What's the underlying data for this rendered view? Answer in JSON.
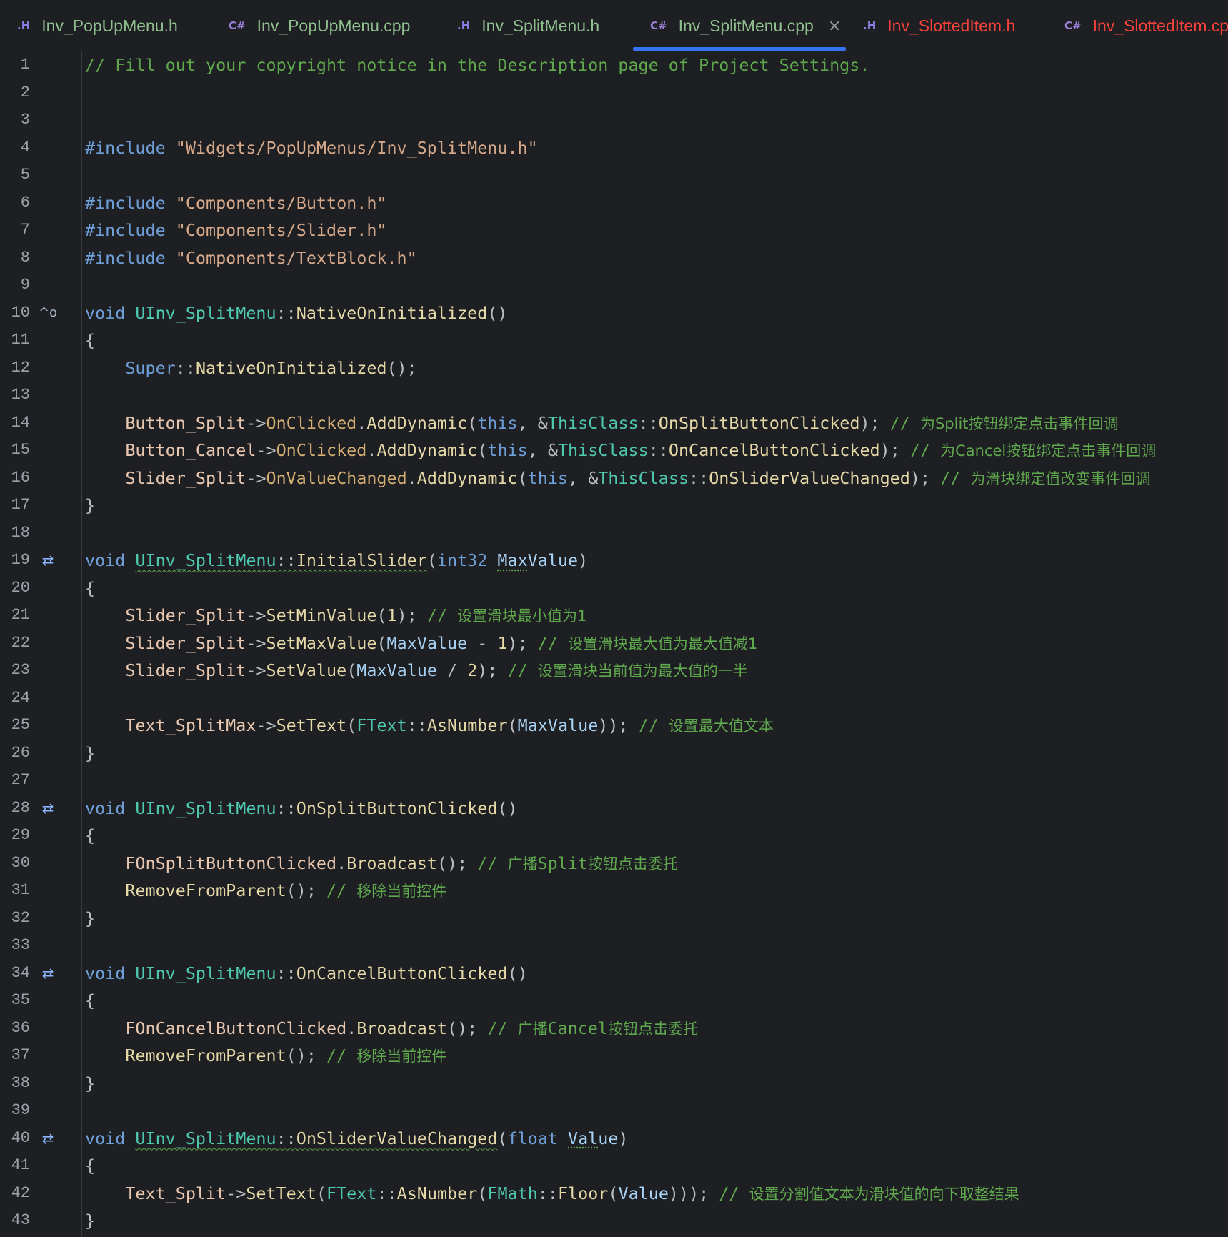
{
  "tabs": [
    {
      "label": "Inv_PopUpMenu.h",
      "type": "h",
      "icon": ".H",
      "state": "normal"
    },
    {
      "label": "Inv_PopUpMenu.cpp",
      "type": "cpp",
      "icon": "C#",
      "state": "normal"
    },
    {
      "label": "Inv_SplitMenu.h",
      "type": "h",
      "icon": ".H",
      "state": "normal"
    },
    {
      "label": "Inv_SplitMenu.cpp",
      "type": "cpp",
      "icon": "C#",
      "state": "active"
    },
    {
      "label": "Inv_SlottedItem.h",
      "type": "h",
      "icon": ".H",
      "state": "error"
    },
    {
      "label": "Inv_SlottedItem.cpp",
      "type": "cpp",
      "icon": "C#",
      "state": "error"
    }
  ],
  "active_tab_close": "×",
  "gutter_icons": {
    "10": {
      "name": "override-icon",
      "glyph": "^o"
    },
    "19": {
      "name": "implementation-switch-icon",
      "glyph": "⇄"
    },
    "28": {
      "name": "implementation-switch-icon",
      "glyph": "⇄"
    },
    "34": {
      "name": "implementation-switch-icon",
      "glyph": "⇄"
    },
    "40": {
      "name": "implementation-switch-icon",
      "glyph": "⇄"
    }
  },
  "lines": [
    [
      [
        "cm",
        "// Fill out your copyright notice in the Description page of Project Settings."
      ]
    ],
    [],
    [],
    [
      [
        "pp",
        "#include "
      ],
      [
        "str",
        "\"Widgets/PopUpMenus/Inv_SplitMenu.h\""
      ]
    ],
    [],
    [
      [
        "pp",
        "#include "
      ],
      [
        "str",
        "\"Components/Button.h\""
      ]
    ],
    [
      [
        "pp",
        "#include "
      ],
      [
        "str",
        "\"Components/Slider.h\""
      ]
    ],
    [
      [
        "pp",
        "#include "
      ],
      [
        "str",
        "\"Components/TextBlock.h\""
      ]
    ],
    [],
    [
      [
        "kw",
        "void "
      ],
      [
        "cls",
        "UInv_SplitMenu"
      ],
      [
        "pn",
        "::"
      ],
      [
        "fn",
        "NativeOnInitialized"
      ],
      [
        "pn",
        "()"
      ]
    ],
    [
      [
        "pn",
        "{"
      ]
    ],
    [
      [
        "pn",
        "    "
      ],
      [
        "sup",
        "Super"
      ],
      [
        "pn",
        "::"
      ],
      [
        "fn",
        "NativeOnInitialized"
      ],
      [
        "pn",
        "();"
      ]
    ],
    [],
    [
      [
        "pn",
        "    "
      ],
      [
        "var",
        "Button_Split"
      ],
      [
        "op",
        "->"
      ],
      [
        "mac",
        "OnClicked"
      ],
      [
        "pn",
        "."
      ],
      [
        "fn",
        "AddDynamic"
      ],
      [
        "pn",
        "("
      ],
      [
        "kw",
        "this"
      ],
      [
        "pn",
        ", &"
      ],
      [
        "cls",
        "ThisClass"
      ],
      [
        "pn",
        "::"
      ],
      [
        "fn",
        "OnSplitButtonClicked"
      ],
      [
        "pn",
        "); "
      ],
      [
        "cm",
        "// "
      ],
      [
        "cmz",
        "为Split按钮绑定点击事件回调"
      ]
    ],
    [
      [
        "pn",
        "    "
      ],
      [
        "var",
        "Button_Cancel"
      ],
      [
        "op",
        "->"
      ],
      [
        "mac",
        "OnClicked"
      ],
      [
        "pn",
        "."
      ],
      [
        "fn",
        "AddDynamic"
      ],
      [
        "pn",
        "("
      ],
      [
        "kw",
        "this"
      ],
      [
        "pn",
        ", &"
      ],
      [
        "cls",
        "ThisClass"
      ],
      [
        "pn",
        "::"
      ],
      [
        "fn",
        "OnCancelButtonClicked"
      ],
      [
        "pn",
        "); "
      ],
      [
        "cm",
        "// "
      ],
      [
        "cmz",
        "为Cancel按钮绑定点击事件回调"
      ]
    ],
    [
      [
        "pn",
        "    "
      ],
      [
        "var",
        "Slider_Split"
      ],
      [
        "op",
        "->"
      ],
      [
        "mac",
        "OnValueChanged"
      ],
      [
        "pn",
        "."
      ],
      [
        "fn",
        "AddDynamic"
      ],
      [
        "pn",
        "("
      ],
      [
        "kw",
        "this"
      ],
      [
        "pn",
        ", &"
      ],
      [
        "cls",
        "ThisClass"
      ],
      [
        "pn",
        "::"
      ],
      [
        "fn",
        "OnSliderValueChanged"
      ],
      [
        "pn",
        "); "
      ],
      [
        "cm",
        "// "
      ],
      [
        "cmz",
        "为滑块绑定值改变事件回调"
      ]
    ],
    [
      [
        "pn",
        "}"
      ]
    ],
    [],
    [
      [
        "kw",
        "void "
      ],
      [
        "cls squig",
        "UInv_SplitMenu"
      ],
      [
        "pn squig",
        "::"
      ],
      [
        "fn squig",
        "InitialSlider"
      ],
      [
        "pn",
        "("
      ],
      [
        "kw",
        "int32 "
      ],
      [
        "prm dotu",
        "Max"
      ],
      [
        "prm",
        "Value"
      ],
      [
        "pn",
        ")"
      ]
    ],
    [
      [
        "pn",
        "{"
      ]
    ],
    [
      [
        "pn",
        "    "
      ],
      [
        "var",
        "Slider_Split"
      ],
      [
        "op",
        "->"
      ],
      [
        "fn",
        "SetMinValue"
      ],
      [
        "pn",
        "("
      ],
      [
        "num",
        "1"
      ],
      [
        "pn",
        "); "
      ],
      [
        "cm",
        "// "
      ],
      [
        "cmz",
        "设置滑块最小值为1"
      ]
    ],
    [
      [
        "pn",
        "    "
      ],
      [
        "var",
        "Slider_Split"
      ],
      [
        "op",
        "->"
      ],
      [
        "fn",
        "SetMaxValue"
      ],
      [
        "pn",
        "("
      ],
      [
        "prm",
        "MaxValue"
      ],
      [
        "pn",
        " - "
      ],
      [
        "num",
        "1"
      ],
      [
        "pn",
        "); "
      ],
      [
        "cm",
        "// "
      ],
      [
        "cmz",
        "设置滑块最大值为最大值减1"
      ]
    ],
    [
      [
        "pn",
        "    "
      ],
      [
        "var",
        "Slider_Split"
      ],
      [
        "op",
        "->"
      ],
      [
        "fn",
        "SetValue"
      ],
      [
        "pn",
        "("
      ],
      [
        "prm",
        "MaxValue"
      ],
      [
        "pn",
        " / "
      ],
      [
        "num",
        "2"
      ],
      [
        "pn",
        "); "
      ],
      [
        "cm",
        "// "
      ],
      [
        "cmz",
        "设置滑块当前值为最大值的一半"
      ]
    ],
    [],
    [
      [
        "pn",
        "    "
      ],
      [
        "var",
        "Text_SplitMax"
      ],
      [
        "op",
        "->"
      ],
      [
        "fn",
        "SetText"
      ],
      [
        "pn",
        "("
      ],
      [
        "cls",
        "FText"
      ],
      [
        "pn",
        "::"
      ],
      [
        "fn",
        "AsNumber"
      ],
      [
        "pn",
        "("
      ],
      [
        "prm",
        "MaxValue"
      ],
      [
        "pn",
        "));"
      ],
      [
        "pn",
        " "
      ],
      [
        "cm",
        "// "
      ],
      [
        "cmz",
        "设置最大值文本"
      ]
    ],
    [
      [
        "pn",
        "}"
      ]
    ],
    [],
    [
      [
        "kw",
        "void "
      ],
      [
        "cls",
        "UInv_SplitMenu"
      ],
      [
        "pn",
        "::"
      ],
      [
        "fn",
        "OnSplitButtonClicked"
      ],
      [
        "pn",
        "()"
      ]
    ],
    [
      [
        "pn",
        "{"
      ]
    ],
    [
      [
        "pn",
        "    "
      ],
      [
        "var",
        "FOnSplitButtonClicked"
      ],
      [
        "pn",
        "."
      ],
      [
        "fn",
        "Broadcast"
      ],
      [
        "pn",
        "(); "
      ],
      [
        "cm",
        "// "
      ],
      [
        "cmz",
        "广播"
      ],
      [
        "cm",
        "Split"
      ],
      [
        "cmz",
        "按钮点击委托"
      ]
    ],
    [
      [
        "pn",
        "    "
      ],
      [
        "fn",
        "RemoveFromParent"
      ],
      [
        "pn",
        "(); "
      ],
      [
        "cm",
        "// "
      ],
      [
        "cmz",
        "移除当前控件"
      ]
    ],
    [
      [
        "pn",
        "}"
      ]
    ],
    [],
    [
      [
        "kw",
        "void "
      ],
      [
        "cls",
        "UInv_SplitMenu"
      ],
      [
        "pn",
        "::"
      ],
      [
        "fn",
        "OnCancelButtonClicked"
      ],
      [
        "pn",
        "()"
      ]
    ],
    [
      [
        "pn",
        "{"
      ]
    ],
    [
      [
        "pn",
        "    "
      ],
      [
        "var",
        "FOnCancelButtonClicked"
      ],
      [
        "pn",
        "."
      ],
      [
        "fn",
        "Broadcast"
      ],
      [
        "pn",
        "(); "
      ],
      [
        "cm",
        "// "
      ],
      [
        "cmz",
        "广播"
      ],
      [
        "cm",
        "Cancel"
      ],
      [
        "cmz",
        "按钮点击委托"
      ]
    ],
    [
      [
        "pn",
        "    "
      ],
      [
        "fn",
        "RemoveFromParent"
      ],
      [
        "pn",
        "(); "
      ],
      [
        "cm",
        "// "
      ],
      [
        "cmz",
        "移除当前控件"
      ]
    ],
    [
      [
        "pn",
        "}"
      ]
    ],
    [],
    [
      [
        "kw",
        "void "
      ],
      [
        "cls squig",
        "UInv_SplitMenu"
      ],
      [
        "pn squig",
        "::"
      ],
      [
        "fn squig",
        "OnSliderValueChanged"
      ],
      [
        "pn",
        "("
      ],
      [
        "kw",
        "float "
      ],
      [
        "prm dotu",
        "Val"
      ],
      [
        "prm",
        "ue"
      ],
      [
        "pn",
        ")"
      ]
    ],
    [
      [
        "pn",
        "{"
      ]
    ],
    [
      [
        "pn",
        "    "
      ],
      [
        "var",
        "Text_Split"
      ],
      [
        "op",
        "->"
      ],
      [
        "fn",
        "SetText"
      ],
      [
        "pn",
        "("
      ],
      [
        "cls",
        "FText"
      ],
      [
        "pn",
        "::"
      ],
      [
        "fn",
        "AsNumber"
      ],
      [
        "pn",
        "("
      ],
      [
        "cls",
        "FMath"
      ],
      [
        "pn",
        "::"
      ],
      [
        "fn",
        "Floor"
      ],
      [
        "pn",
        "("
      ],
      [
        "prm",
        "Value"
      ],
      [
        "pn",
        ")));"
      ],
      [
        "pn",
        " "
      ],
      [
        "cm",
        "// "
      ],
      [
        "cmz",
        "设置分割值文本为滑块值的向下取整结果"
      ]
    ],
    [
      [
        "pn",
        "}"
      ]
    ]
  ]
}
